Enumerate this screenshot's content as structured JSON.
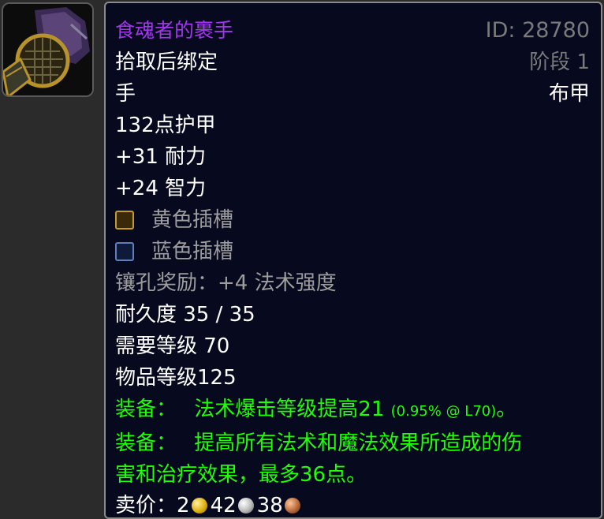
{
  "item": {
    "name": "食魂者的裹手",
    "id_label": "ID: 28780",
    "phase_label": "阶段 1",
    "bind": "拾取后绑定",
    "slot": "手",
    "armor_type": "布甲",
    "armor": "132点护甲",
    "stats": [
      "+31 耐力",
      "+24 智力"
    ],
    "sockets": [
      {
        "label": "黄色插槽",
        "icon": "yellow-socket-icon",
        "color": "#c49b2a"
      },
      {
        "label": "蓝色插槽",
        "icon": "blue-socket-icon",
        "color": "#5f7fb8"
      }
    ],
    "socket_bonus": "镶孔奖励：+4 法术强度",
    "durability": "耐久度 35 / 35",
    "required_level": "需要等级 70",
    "item_level": "物品等级125",
    "equip_effects": [
      {
        "prefix": "装备：",
        "text": "法术爆击等级提高21",
        "note": "(0.95% @ L70)",
        "suffix": "。"
      },
      {
        "prefix": "装备：",
        "line1": "提高所有法术和魔法效果所造成的伤",
        "line2": "害和治疗效果，最多36点。"
      }
    ],
    "sell_price": {
      "label": "卖价：",
      "gold": "2",
      "silver": "42",
      "copper": "38"
    }
  },
  "colors": {
    "epic": "#a335ee",
    "equip": "#1eff00",
    "background": "#07091f",
    "border": "#8b8b8b"
  },
  "icon": "cloth-gloves-icon"
}
